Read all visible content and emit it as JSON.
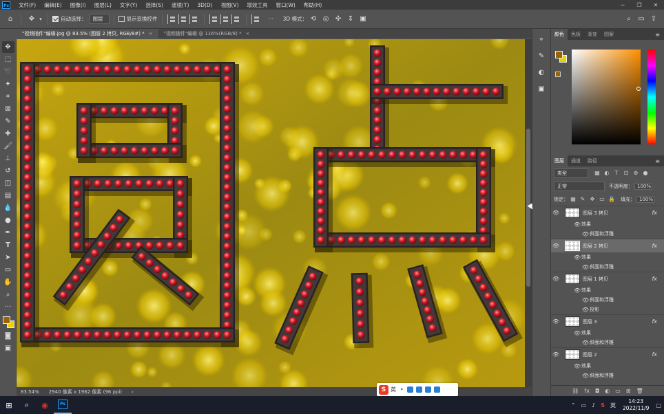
{
  "app": {
    "name": "Adobe Photoshop",
    "logo": "Ps"
  },
  "menu": [
    "文件(F)",
    "编辑(E)",
    "图像(I)",
    "图层(L)",
    "文字(Y)",
    "选择(S)",
    "滤镜(T)",
    "3D(D)",
    "视图(V)",
    "增效工具",
    "窗口(W)",
    "帮助(H)"
  ],
  "options": {
    "auto_select_label": "自动选择：",
    "auto_select_target": "图层",
    "show_transform_label": "显示变换控件",
    "mode3d_label": "3D 模式：",
    "more": "···"
  },
  "tabs": [
    {
      "label": "\"视频插件\"编辑.jpg @ 83.5% (图层 2 拷贝, RGB/8#) *",
      "close": "×"
    },
    {
      "label": "\"视频插件\"编辑 @ 116%(RGB/8) *",
      "close": "×"
    }
  ],
  "canvas": {
    "artwork_text": [
      "圆",
      "点"
    ],
    "colors": {
      "background": "#b99a0e",
      "letter_frame": "#2a2222",
      "dot": "#c8202a",
      "dot_highlight": "#ff8080"
    }
  },
  "status": {
    "zoom": "83.54%",
    "doc_size": "2940 像素 x 1962 像素 (96 ppi)",
    "arrow": "›"
  },
  "color_panel": {
    "tabs": [
      "颜色",
      "色板",
      "渐变",
      "图案"
    ],
    "fg_color": "#9a6400",
    "bg_color": "#e8d200"
  },
  "layers_panel": {
    "tabs": [
      "图层",
      "通道",
      "路径"
    ],
    "filter_label": "类型",
    "blend_mode": "正常",
    "opacity_label": "不透明度：",
    "opacity_value": "100%",
    "lock_label": "锁定：",
    "fill_label": "填充：",
    "fill_value": "100%",
    "layers": [
      {
        "name": "图层 3 拷贝",
        "fx": "fx",
        "effects_label": "效果",
        "effects": [
          "斜面和浮雕"
        ],
        "selected": false
      },
      {
        "name": "图层 2 拷贝",
        "fx": "fx",
        "effects_label": "效果",
        "effects": [
          "斜面和浮雕"
        ],
        "selected": true
      },
      {
        "name": "图层 1 拷贝",
        "fx": "fx",
        "effects_label": "效果",
        "effects": [
          "斜面和浮雕",
          "投影"
        ],
        "selected": false
      },
      {
        "name": "图层 3",
        "fx": "fx",
        "effects_label": "效果",
        "effects": [
          "斜面和浮雕"
        ],
        "selected": false
      },
      {
        "name": "图层 2",
        "fx": "fx",
        "effects_label": "效果",
        "effects": [
          "斜面和浮雕"
        ],
        "selected": false
      }
    ]
  },
  "ime": {
    "mode": "英"
  },
  "taskbar": {
    "time": "14:23",
    "date": "2022/11/9"
  }
}
